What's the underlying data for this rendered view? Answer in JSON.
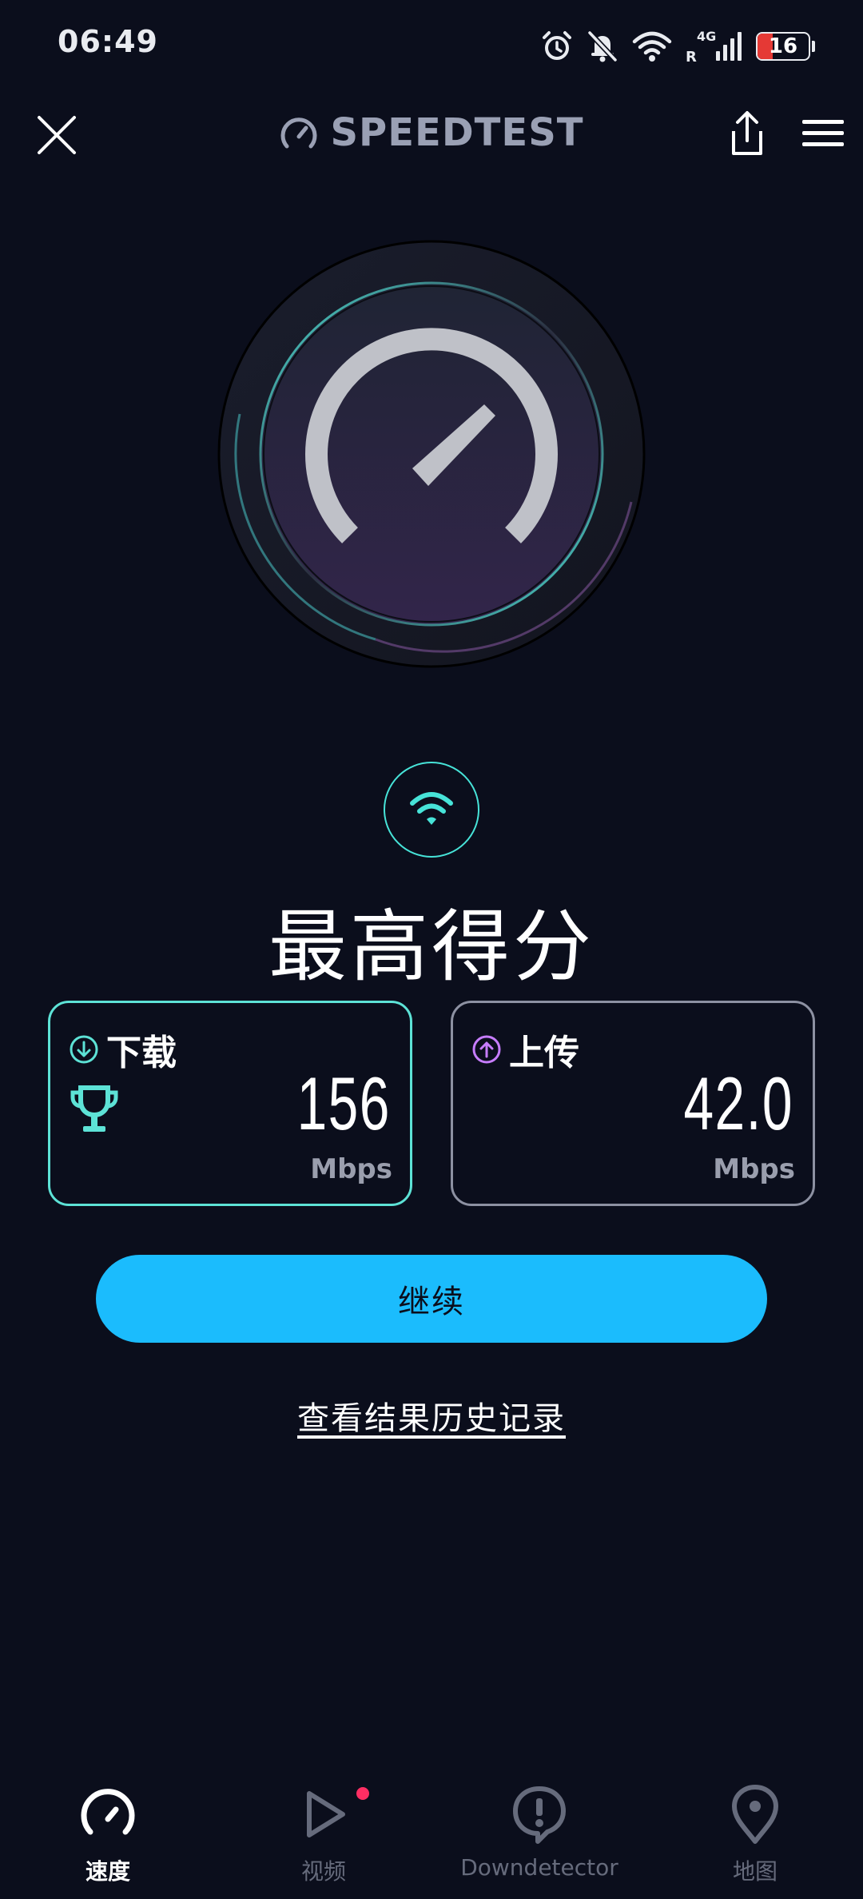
{
  "status_bar": {
    "time": "06:49",
    "network_type": "4G",
    "roaming_indicator": "R",
    "battery_level": "16",
    "icons": [
      "alarm-icon",
      "bell-muted-icon",
      "wifi-icon",
      "cell-signal-icon",
      "battery-icon"
    ]
  },
  "header": {
    "brand": "SPEEDTEST",
    "icons": [
      "close-icon",
      "speedometer-icon",
      "share-icon",
      "menu-icon"
    ]
  },
  "result": {
    "title": "最高得分",
    "connection_icon": "wifi-icon",
    "download": {
      "label": "下载",
      "value": "156",
      "unit": "Mbps",
      "icon": "arrow-down-circle-icon",
      "badge_icon": "trophy-icon"
    },
    "upload": {
      "label": "上传",
      "value": "42.0",
      "unit": "Mbps",
      "icon": "arrow-up-circle-icon"
    }
  },
  "actions": {
    "continue_label": "继续",
    "history_link": "查看结果历史记录"
  },
  "bottom_nav": {
    "items": [
      {
        "label": "速度",
        "icon": "speedometer-icon",
        "active": true
      },
      {
        "label": "视频",
        "icon": "play-icon",
        "active": false,
        "notification_dot": true
      },
      {
        "label": "Downdetector",
        "icon": "alert-bubble-icon",
        "active": false
      },
      {
        "label": "地图",
        "icon": "map-pin-icon",
        "active": false
      }
    ]
  },
  "colors": {
    "background": "#0b0e1c",
    "accent_teal": "#5de2d6",
    "accent_blue": "#1bbcfd",
    "accent_purple": "#c77dff",
    "battery_low": "#e53935",
    "notification": "#ff2e63"
  }
}
